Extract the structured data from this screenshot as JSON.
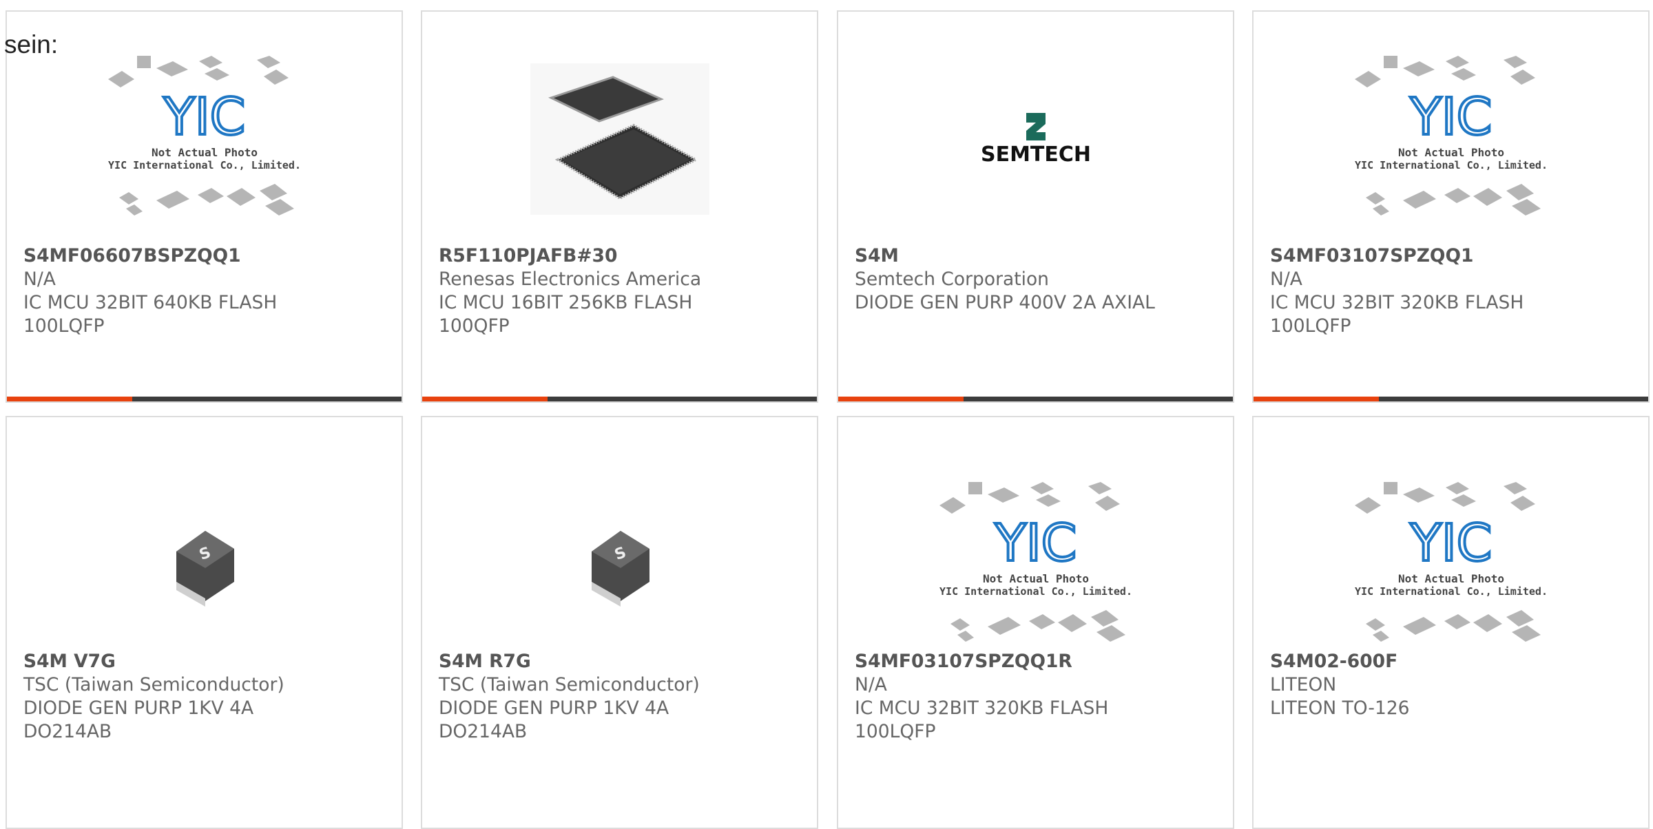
{
  "intro_text": "sein:",
  "colors": {
    "accent": "#e8420e",
    "bar": "#3c3c3c",
    "border": "#dcdcdc",
    "yic_blue": "#1f77c4"
  },
  "placeholder": {
    "line1": "Not Actual Photo",
    "line2": "YIC International Co., Limited.",
    "logo": "YIC"
  },
  "semtech_logo": "SEMTECH",
  "products": [
    {
      "part": "S4MF06607BSPZQQ1",
      "maker": "N/A",
      "desc1": "IC MCU 32BIT 640KB FLASH",
      "desc2": "100LQFP",
      "image": "yic-placeholder"
    },
    {
      "part": "R5F110PJAFB#30",
      "maker": "Renesas Electronics America",
      "desc1": "IC MCU 16BIT 256KB FLASH",
      "desc2": "100QFP",
      "image": "qfp-chip"
    },
    {
      "part": "S4M",
      "maker": "Semtech Corporation",
      "desc1": "DIODE GEN PURP 400V 2A AXIAL",
      "desc2": "",
      "image": "semtech-logo"
    },
    {
      "part": "S4MF03107SPZQQ1",
      "maker": "N/A",
      "desc1": "IC MCU 32BIT 320KB FLASH",
      "desc2": "100LQFP",
      "image": "yic-placeholder"
    },
    {
      "part": "S4M V7G",
      "maker": "TSC (Taiwan Semiconductor)",
      "desc1": "DIODE GEN PURP 1KV 4A",
      "desc2": "DO214AB",
      "image": "smd-diode"
    },
    {
      "part": "S4M R7G",
      "maker": "TSC (Taiwan Semiconductor)",
      "desc1": "DIODE GEN PURP 1KV 4A",
      "desc2": "DO214AB",
      "image": "smd-diode"
    },
    {
      "part": "S4MF03107SPZQQ1R",
      "maker": "N/A",
      "desc1": "IC MCU 32BIT 320KB FLASH",
      "desc2": "100LQFP",
      "image": "yic-placeholder"
    },
    {
      "part": "S4M02-600F",
      "maker": "LITEON",
      "desc1": "LITEON TO-126",
      "desc2": "",
      "image": "yic-placeholder"
    }
  ]
}
